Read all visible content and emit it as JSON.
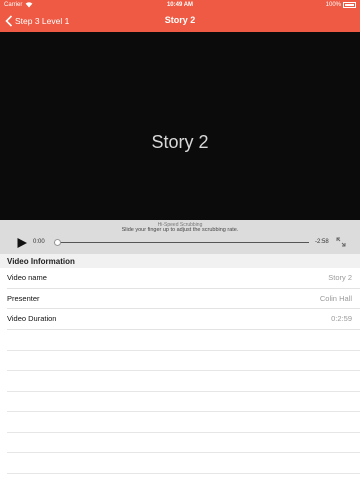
{
  "status_bar": {
    "carrier": "Carrier",
    "time": "10:49 AM",
    "battery": "100%"
  },
  "nav": {
    "back_label": "Step 3 Level 1",
    "title": "Story 2",
    "accent_color": "#ee5a43"
  },
  "video": {
    "title": "Story 2"
  },
  "player": {
    "scrub_hint_title": "Hi-Speed Scrubbing",
    "scrub_hint_text": "Slide your finger up to adjust the scrubbing rate.",
    "current_time": "0:00",
    "remaining_time": "-2:58",
    "progress": 0.01
  },
  "video_info": {
    "header": "Video Information",
    "rows": [
      {
        "label": "Video name",
        "value": "Story 2"
      },
      {
        "label": "Presenter",
        "value": "Colin Hall"
      },
      {
        "label": "Video Duration",
        "value": "0:2:59"
      }
    ]
  }
}
